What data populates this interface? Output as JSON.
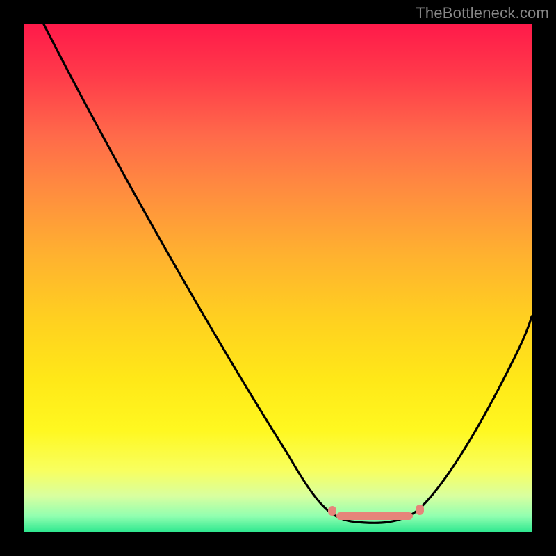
{
  "watermark": "TheBottleneck.com",
  "chart_data": {
    "type": "line",
    "title": "",
    "xlabel": "",
    "ylabel": "",
    "xlim": [
      0,
      100
    ],
    "ylim": [
      0,
      100
    ],
    "background_gradient": {
      "top_color": "#ff1a4a",
      "bottom_color": "#30e890",
      "meaning": "top=high bottleneck (bad), bottom=low bottleneck (good)"
    },
    "series": [
      {
        "name": "bottleneck-curve",
        "description": "V-shaped curve; y represents bottleneck magnitude (100=worst at top, 0=best at bottom). Minimum near x≈70 marks the ideal match point.",
        "x": [
          0,
          5,
          10,
          15,
          20,
          25,
          30,
          35,
          40,
          45,
          50,
          55,
          58,
          60,
          62,
          65,
          68,
          70,
          72,
          75,
          78,
          80,
          83,
          86,
          90,
          95,
          100
        ],
        "y": [
          100,
          92,
          84,
          76,
          68,
          60,
          52,
          44,
          36,
          28,
          20,
          12,
          7,
          4,
          2,
          1,
          1,
          1,
          1,
          2,
          4,
          8,
          14,
          22,
          32,
          44,
          55
        ]
      }
    ],
    "optimal_region": {
      "x_start": 60,
      "x_end": 78,
      "marker_color": "#e6847a",
      "description": "Flat trough segment marked near the bottom indicating the optimal / balanced zone."
    }
  }
}
